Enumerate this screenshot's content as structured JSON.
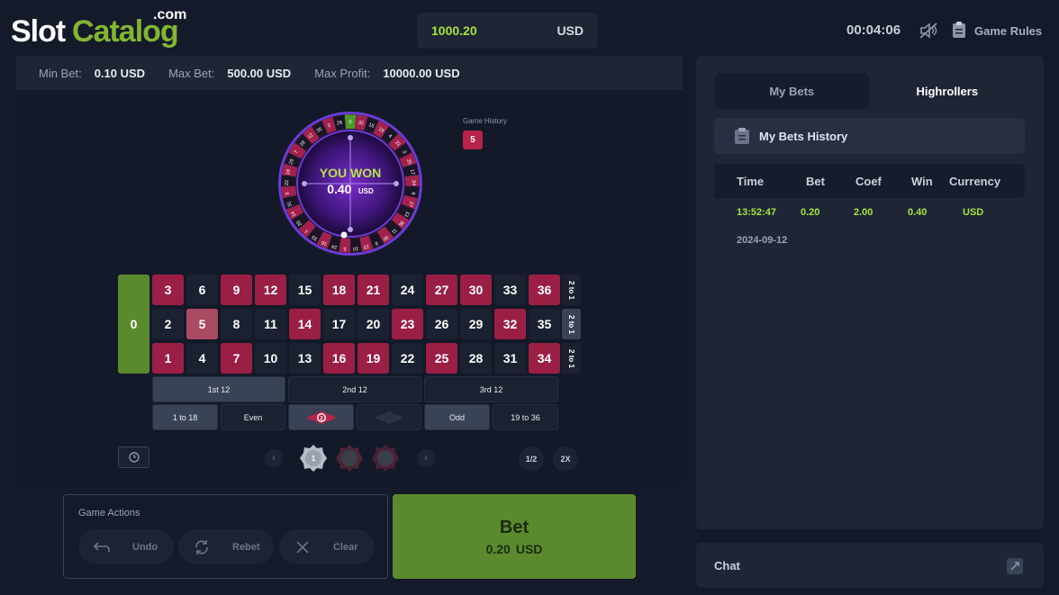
{
  "logo": {
    "slot": "Slot",
    "catalog": "Catalog",
    "com": ".com"
  },
  "balance": {
    "amount": "1000.20",
    "currency": "USD"
  },
  "timer": "00:04:06",
  "game_rules": "Game Rules",
  "limits": {
    "min_label": "Min Bet:",
    "min_value": "0.10 USD",
    "max_label": "Max Bet:",
    "max_value": "500.00 USD",
    "profit_label": "Max Profit:",
    "profit_value": "10000.00 USD"
  },
  "wheel": {
    "result_text": "YOU WON",
    "result_amount": "0.40",
    "result_currency": "USD",
    "winning_number": "5"
  },
  "game_history": {
    "label": "Game History",
    "last": "5"
  },
  "board": {
    "zero": "0",
    "rows": [
      [
        {
          "n": "3",
          "c": "red"
        },
        {
          "n": "6",
          "c": "black"
        },
        {
          "n": "9",
          "c": "red"
        },
        {
          "n": "12",
          "c": "red"
        },
        {
          "n": "15",
          "c": "black"
        },
        {
          "n": "18",
          "c": "red"
        },
        {
          "n": "21",
          "c": "red"
        },
        {
          "n": "24",
          "c": "black"
        },
        {
          "n": "27",
          "c": "red"
        },
        {
          "n": "30",
          "c": "red"
        },
        {
          "n": "33",
          "c": "black"
        },
        {
          "n": "36",
          "c": "red"
        }
      ],
      [
        {
          "n": "2",
          "c": "black"
        },
        {
          "n": "5",
          "c": "hl"
        },
        {
          "n": "8",
          "c": "black"
        },
        {
          "n": "11",
          "c": "black"
        },
        {
          "n": "14",
          "c": "red"
        },
        {
          "n": "17",
          "c": "black"
        },
        {
          "n": "20",
          "c": "black"
        },
        {
          "n": "23",
          "c": "red"
        },
        {
          "n": "26",
          "c": "black"
        },
        {
          "n": "29",
          "c": "black"
        },
        {
          "n": "32",
          "c": "red"
        },
        {
          "n": "35",
          "c": "black"
        }
      ],
      [
        {
          "n": "1",
          "c": "red"
        },
        {
          "n": "4",
          "c": "black"
        },
        {
          "n": "7",
          "c": "red"
        },
        {
          "n": "10",
          "c": "black"
        },
        {
          "n": "13",
          "c": "black"
        },
        {
          "n": "16",
          "c": "red"
        },
        {
          "n": "19",
          "c": "red"
        },
        {
          "n": "22",
          "c": "black"
        },
        {
          "n": "25",
          "c": "red"
        },
        {
          "n": "28",
          "c": "black"
        },
        {
          "n": "31",
          "c": "black"
        },
        {
          "n": "34",
          "c": "red"
        }
      ]
    ],
    "column_bet": "2 to 1",
    "dozens": [
      "1st 12",
      "2nd 12",
      "3rd 12"
    ],
    "outside": {
      "low": "1 to 18",
      "even": "Even",
      "odd": "Odd",
      "high": "19 to 36",
      "red_chip": "2"
    }
  },
  "chips": {
    "selected": "1",
    "half": "1/2",
    "double": "2X"
  },
  "actions": {
    "title": "Game Actions",
    "undo": "Undo",
    "rebet": "Rebet",
    "clear": "Clear"
  },
  "bet_button": {
    "label": "Bet",
    "amount": "0.20",
    "currency": "USD"
  },
  "panel": {
    "tab_my_bets": "My Bets",
    "tab_highrollers": "Highrollers",
    "history_label": "My Bets History",
    "columns": [
      "Time",
      "Bet",
      "Coef",
      "Win",
      "Currency"
    ],
    "row": {
      "time": "13:52:47",
      "bet": "0.20",
      "coef": "2.00",
      "win": "0.40",
      "currency": "USD",
      "date": "2024-09-12"
    }
  },
  "chat": {
    "label": "Chat"
  },
  "colors": {
    "red": "#9b1f45",
    "black": "#1a2130",
    "green": "#5b8a2e",
    "accent": "#a6e33c"
  }
}
